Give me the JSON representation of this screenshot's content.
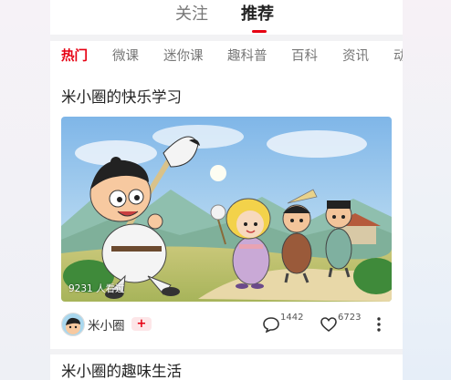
{
  "top_tabs": [
    {
      "label": "关注",
      "active": false
    },
    {
      "label": "推荐",
      "active": true
    }
  ],
  "categories": [
    {
      "label": "热门",
      "active": true
    },
    {
      "label": "微课",
      "active": false
    },
    {
      "label": "迷你课",
      "active": false
    },
    {
      "label": "趣科普",
      "active": false
    },
    {
      "label": "百科",
      "active": false
    },
    {
      "label": "资讯",
      "active": false
    },
    {
      "label": "动",
      "active": false
    }
  ],
  "card": {
    "title": "米小圈的快乐学习",
    "views": "9231 人看过",
    "author": "米小圈",
    "follow_badge": "+",
    "comments": "1442",
    "likes": "6723"
  },
  "next_card": {
    "title": "米小圈的趣味生活"
  },
  "colors": {
    "accent": "#e60012"
  }
}
